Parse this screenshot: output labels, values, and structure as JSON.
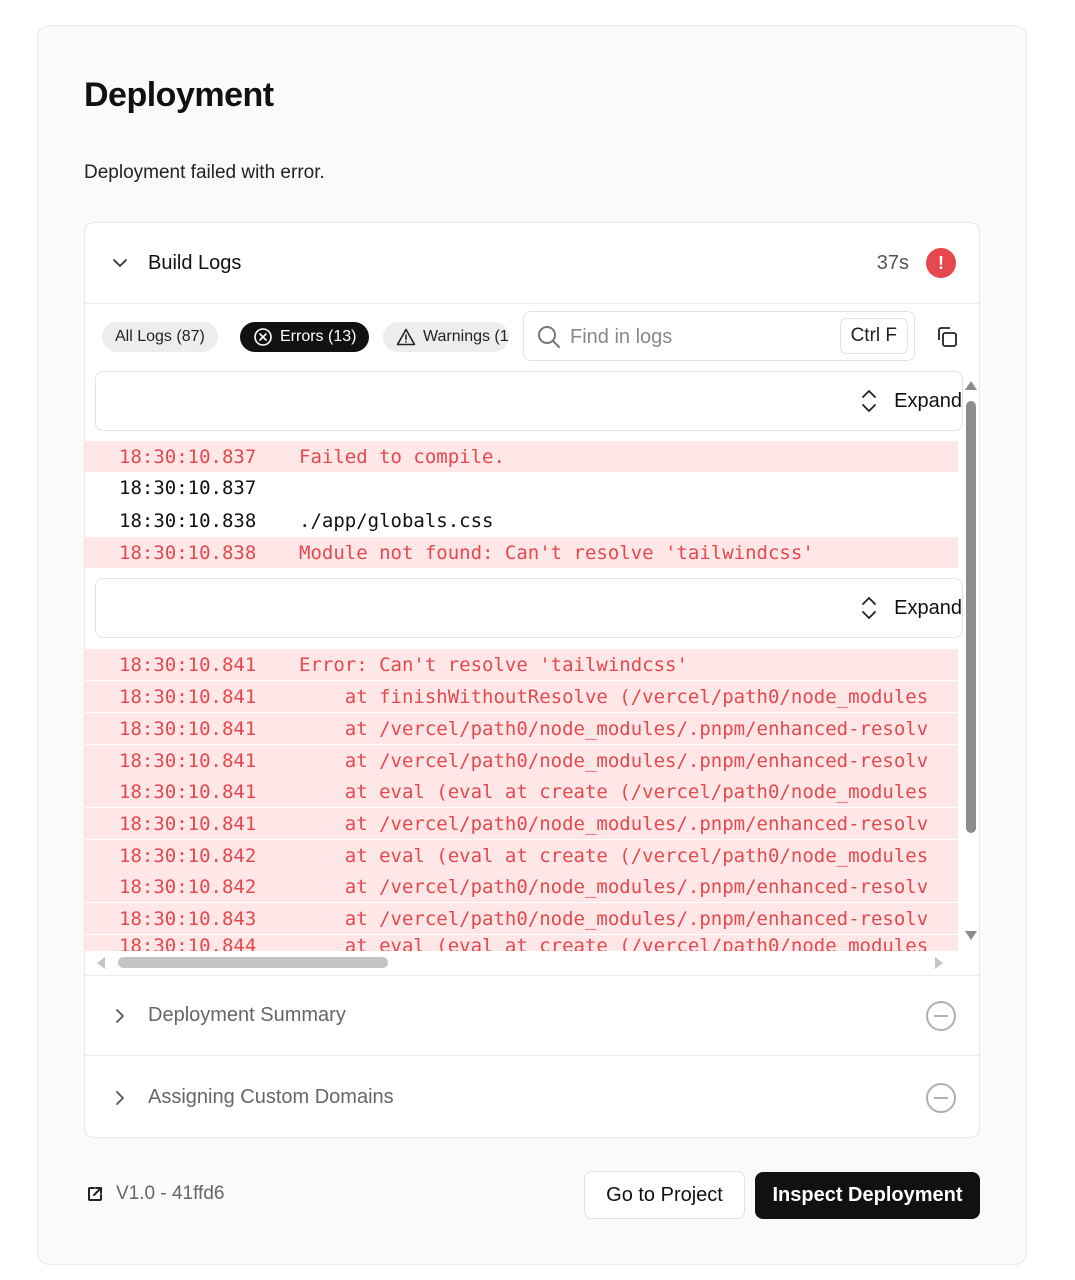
{
  "header": {
    "title": "Deployment",
    "status": "Deployment failed with error."
  },
  "build_logs": {
    "title": "Build Logs",
    "duration": "37s",
    "error_badge": "!",
    "status_color": "#e5484d",
    "filters": {
      "all": "All Logs (87)",
      "errors": "Errors (13)",
      "warnings": "Warnings (1"
    },
    "search": {
      "placeholder": "Find in logs",
      "value": "",
      "shortcut": "Ctrl F"
    },
    "expand_label": "Expand",
    "lines": [
      {
        "time": "18:30:10.837",
        "message": "Failed to compile.",
        "level": "error"
      },
      {
        "time": "18:30:10.837",
        "message": "",
        "level": "info"
      },
      {
        "time": "18:30:10.838",
        "message": "./app/globals.css",
        "level": "info"
      },
      {
        "time": "18:30:10.838",
        "message": "Module not found: Can't resolve 'tailwindcss'",
        "level": "error"
      },
      {
        "time": "18:30:10.841",
        "message": "Error: Can't resolve 'tailwindcss'",
        "level": "error"
      },
      {
        "time": "18:30:10.841",
        "message": "    at finishWithoutResolve (/vercel/path0/node_modules",
        "level": "error"
      },
      {
        "time": "18:30:10.841",
        "message": "    at /vercel/path0/node_modules/.pnpm/enhanced-resolv",
        "level": "error"
      },
      {
        "time": "18:30:10.841",
        "message": "    at /vercel/path0/node_modules/.pnpm/enhanced-resolv",
        "level": "error"
      },
      {
        "time": "18:30:10.841",
        "message": "    at eval (eval at create (/vercel/path0/node_modules",
        "level": "error"
      },
      {
        "time": "18:30:10.841",
        "message": "    at /vercel/path0/node_modules/.pnpm/enhanced-resolv",
        "level": "error"
      },
      {
        "time": "18:30:10.842",
        "message": "    at eval (eval at create (/vercel/path0/node_modules",
        "level": "error"
      },
      {
        "time": "18:30:10.842",
        "message": "    at /vercel/path0/node_modules/.pnpm/enhanced-resolv",
        "level": "error"
      },
      {
        "time": "18:30:10.843",
        "message": "    at /vercel/path0/node_modules/.pnpm/enhanced-resolv",
        "level": "error"
      },
      {
        "time": "18:30:10.844",
        "message": "    at eval (eval at create (/vercel/path0/node_modules",
        "level": "error"
      }
    ]
  },
  "sections": {
    "summary": "Deployment Summary",
    "domains": "Assigning Custom Domains"
  },
  "footer": {
    "version": "V1.0 - 41ffd6",
    "go_to_project": "Go to Project",
    "inspect": "Inspect Deployment"
  },
  "icons": {
    "collapse": "chevron-down-icon",
    "expand_section": "chevron-right-icon",
    "error_filter": "x-circle-icon",
    "warning_filter": "warning-triangle-icon",
    "search": "search-icon",
    "copy": "copy-icon",
    "expand": "chevron-up-down-icon",
    "skipped": "minus-circle-icon",
    "external": "external-link-icon"
  }
}
